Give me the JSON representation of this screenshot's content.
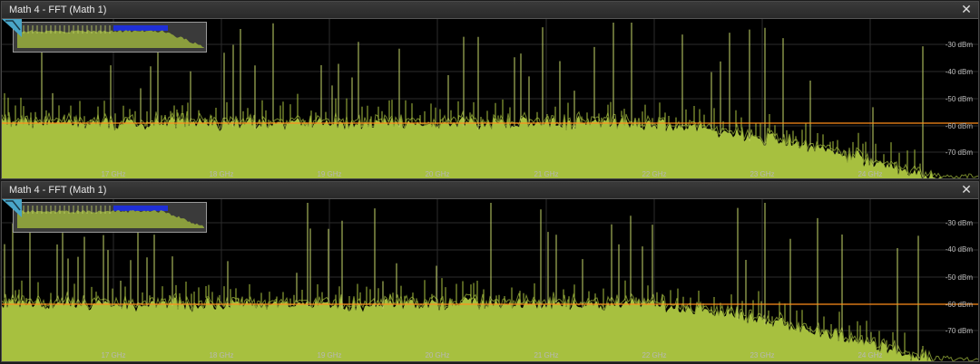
{
  "panels": [
    {
      "title": "Math 4 - FFT (Math 1)",
      "close_icon": "close-icon"
    },
    {
      "title": "Math 4 - FFT (Math 1)",
      "close_icon": "close-icon"
    }
  ],
  "y_axis_labels": [
    "-30 dBm",
    "-40 dBm",
    "-50 dBm",
    "-60 dBm",
    "-70 dBm"
  ],
  "x_axis_labels": [
    "17 GHz",
    "18 GHz",
    "19 GHz",
    "20 GHz",
    "21 GHz",
    "22 GHz",
    "23 GHz",
    "24 GHz"
  ],
  "cursor_level": "-60 dBm",
  "colors": {
    "trace": "#a7c03f",
    "spur": "#c6d86a",
    "cursor": "#ff8c1a",
    "grid": "#2c2c2c",
    "overview_window": "#1f2fd6",
    "corner_icon": "#4aa6c8"
  },
  "icons": [
    "close-icon",
    "zoom-overview-icon",
    "waveform-handle-icon"
  ]
}
